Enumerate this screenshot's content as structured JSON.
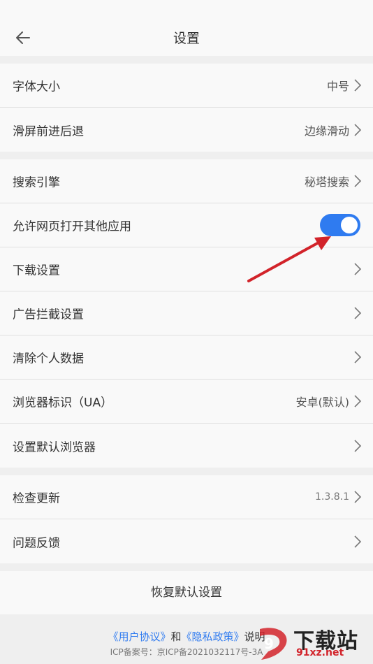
{
  "header": {
    "title": "设置",
    "back_icon": "arrow-left-icon"
  },
  "groups": [
    {
      "items": [
        {
          "label": "字体大小",
          "value": "中号"
        },
        {
          "label": "滑屏前进后退",
          "value": "边缘滑动"
        }
      ]
    },
    {
      "items": [
        {
          "label": "搜索引擎",
          "value": "秘塔搜索"
        },
        {
          "label": "允许网页打开其他应用",
          "toggle": true
        },
        {
          "label": "下载设置"
        },
        {
          "label": "广告拦截设置"
        },
        {
          "label": "清除个人数据"
        },
        {
          "label": "浏览器标识（UA）",
          "value": "安卓(默认)"
        },
        {
          "label": "设置默认浏览器"
        }
      ]
    },
    {
      "items": [
        {
          "label": "检查更新",
          "value": "1.3.8.1"
        },
        {
          "label": "问题反馈"
        }
      ]
    }
  ],
  "reset_label": "恢复默认设置",
  "footer": {
    "user_agreement": "《用户协议》",
    "and": "和",
    "privacy_policy": "《隐私政策》",
    "explain": "说明",
    "icp": "ICP备案号：京ICP备2021032117号-3A"
  },
  "watermark": {
    "main": "下载站",
    "sub": "91xz.net"
  },
  "colors": {
    "accent": "#2f7bf0",
    "annotation_arrow": "#d2232a"
  }
}
